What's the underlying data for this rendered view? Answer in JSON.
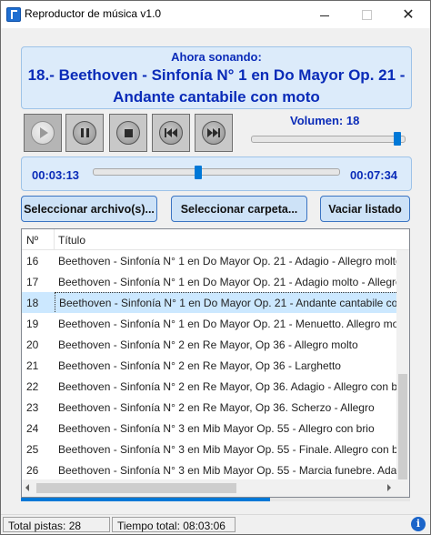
{
  "window": {
    "title": "Reproductor de música v1.0",
    "min_glyph": "",
    "close_glyph": "✕"
  },
  "now_playing": {
    "label": "Ahora sonando:",
    "song": "18.- Beethoven - Sinfonía N° 1 en Do Mayor Op. 21 - Andante cantabile con moto"
  },
  "volume": {
    "label": "Volumen: 18",
    "level": 0.97
  },
  "seek": {
    "current": "00:03:13",
    "total": "00:07:34",
    "position": 0.425
  },
  "buttons": {
    "select_files": "Seleccionar archivo(s)...",
    "select_folder": "Seleccionar carpeta...",
    "clear_list": "Vaciar listado"
  },
  "list": {
    "columns": [
      "Nº",
      "Título"
    ],
    "rows": [
      {
        "n": "16",
        "title": "Beethoven - Sinfonía N° 1 en Do Mayor Op. 21 - Adagio - Allegro molto"
      },
      {
        "n": "17",
        "title": "Beethoven - Sinfonía N° 1 en Do Mayor Op. 21 - Adagio molto - Allegro"
      },
      {
        "n": "18",
        "title": "Beethoven - Sinfonía N° 1 en Do Mayor Op. 21 - Andante cantabile con moto",
        "selected": true
      },
      {
        "n": "19",
        "title": "Beethoven - Sinfonía N° 1 en Do Mayor Op. 21 - Menuetto. Allegro molto"
      },
      {
        "n": "20",
        "title": "Beethoven - Sinfonía N° 2 en Re Mayor, Op 36 - Allegro molto"
      },
      {
        "n": "21",
        "title": "Beethoven - Sinfonía N° 2 en Re Mayor, Op 36 - Larghetto"
      },
      {
        "n": "22",
        "title": "Beethoven - Sinfonía N° 2 en Re Mayor, Op 36. Adagio - Allegro con brio"
      },
      {
        "n": "23",
        "title": "Beethoven - Sinfonía N° 2 en Re Mayor, Op 36. Scherzo - Allegro"
      },
      {
        "n": "24",
        "title": "Beethoven - Sinfonía N° 3 en Mib Mayor Op. 55 - Allegro con brio"
      },
      {
        "n": "25",
        "title": "Beethoven - Sinfonía N° 3 en Mib Mayor Op. 55 - Finale. Allegro con brio"
      },
      {
        "n": "26",
        "title": "Beethoven - Sinfonía N° 3 en Mib Mayor Op. 55 - Marcia funebre. Adagio"
      }
    ]
  },
  "playback_progress": 0.64,
  "status": {
    "total_tracks": "Total pistas: 28",
    "total_time": "Tiempo total: 08:03:06"
  },
  "colors": {
    "accent": "#0078d7",
    "heading_blue": "#0a2bb8",
    "selected_row": "#cce8ff"
  }
}
